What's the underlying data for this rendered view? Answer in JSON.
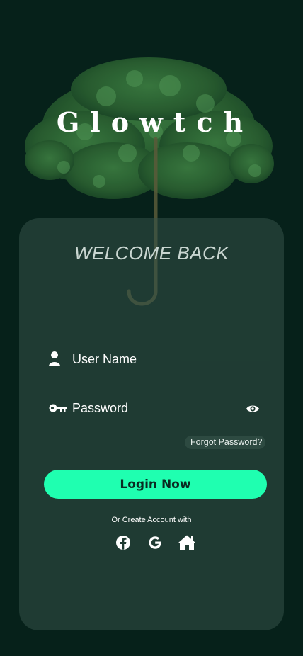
{
  "app": {
    "title": "Glowtch"
  },
  "card": {
    "welcome": "WELCOME BACK"
  },
  "username": {
    "placeholder": "User Name",
    "icon": "user-icon"
  },
  "password": {
    "placeholder": "Password",
    "icon": "key-icon",
    "toggle_icon": "eye-icon"
  },
  "forgot_label": "Forgot Password?",
  "login_label": "Login Now",
  "alt_label": "Or Create Account with",
  "socials": [
    {
      "name": "facebook-icon"
    },
    {
      "name": "google-icon"
    },
    {
      "name": "home-icon"
    }
  ],
  "colors": {
    "background": "#06211a",
    "card": "#1e3a31",
    "accent": "#1fffb0",
    "text": "#ffffff"
  }
}
